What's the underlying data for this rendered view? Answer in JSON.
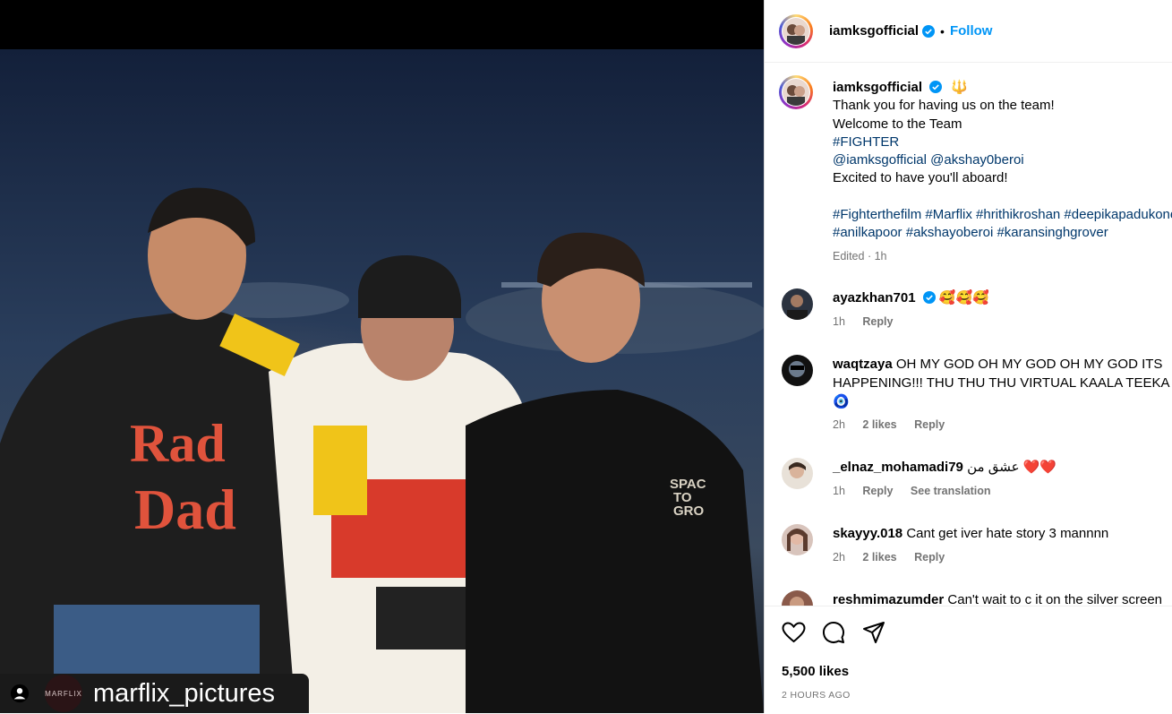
{
  "post": {
    "username": "iamksgofficial",
    "follow_label": "Follow",
    "separator": "•",
    "watermark_handle": "marflix_pictures",
    "watermark_logo_text": "MARFLIX",
    "shirt_text": "Rad Dad",
    "cap_text": "SPACE TO GROW"
  },
  "caption": {
    "username": "iamksgofficial",
    "emoji": "🔱",
    "line1": "Thank you for having us on the team!",
    "line2": "Welcome to the Team",
    "line3_tag": "#FIGHTER",
    "line4_mention1": "@iamksgofficial",
    "line4_mention2": "@akshay0beroi",
    "line5": "Excited to have you'll aboard!",
    "tags_row1": "#Fighterthefilm #Marflix #hrithikroshan #deepikapadukone",
    "tags_row2": "#anilkapoor #akshayoberoi #karansinghgrover",
    "edited": "Edited",
    "edited_dot": "·",
    "edited_time": "1h"
  },
  "comments": [
    {
      "user": "ayazkhan701",
      "verified": true,
      "text": "🥰🥰🥰",
      "time": "1h",
      "likes": "",
      "reply": "Reply",
      "extra": ""
    },
    {
      "user": "waqtzaya",
      "verified": false,
      "text": "OH MY GOD OH MY GOD OH MY GOD ITS",
      "text2": "HAPPENING!!! THU THU THU VIRTUAL KAALA TEEKA",
      "text3": "🧿",
      "time": "2h",
      "likes": "2 likes",
      "reply": "Reply",
      "extra": ""
    },
    {
      "user": "_elnaz_mohamadi79",
      "verified": false,
      "text": "عشق من ❤️❤️",
      "time": "1h",
      "likes": "",
      "reply": "Reply",
      "extra": "See translation"
    },
    {
      "user": "skayyy.018",
      "verified": false,
      "text": "Cant get iver hate story 3 mannnn",
      "time": "2h",
      "likes": "2 likes",
      "reply": "Reply",
      "extra": ""
    },
    {
      "user": "reshmimazumder",
      "verified": false,
      "text": "Can't wait to c it on the silver screen",
      "time": "",
      "likes": "",
      "reply": "",
      "extra": ""
    }
  ],
  "footer": {
    "likes": "5,500 likes",
    "time_ago": "2 HOURS AGO"
  },
  "icons": [
    "heart-icon",
    "comment-icon",
    "share-icon",
    "verified-icon",
    "user-tag-icon"
  ],
  "colors": {
    "accent": "#0095f6",
    "verified": "#0095f6",
    "hashtag": "#00376b",
    "muted": "#737373"
  }
}
